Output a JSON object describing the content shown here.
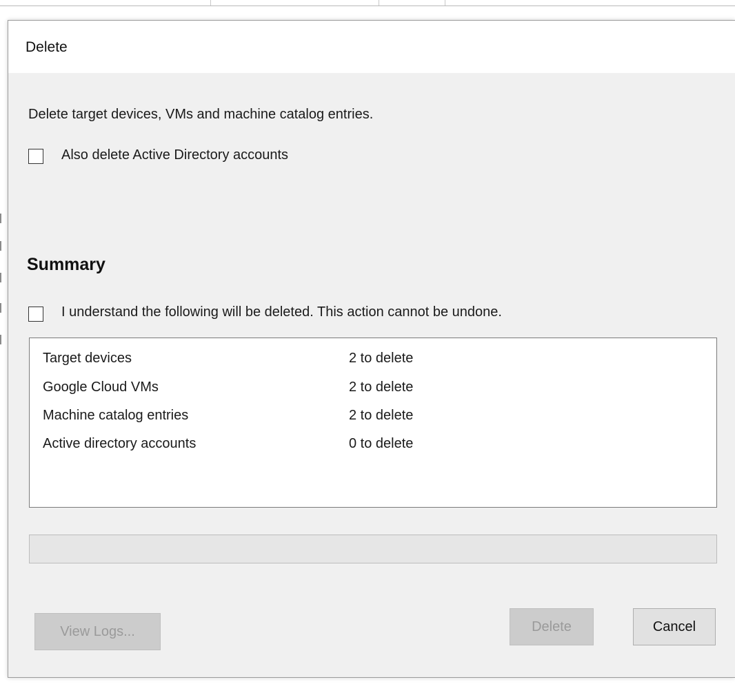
{
  "dialog": {
    "title": "Delete",
    "description": "Delete target devices, VMs and machine catalog entries.",
    "also_delete_ad": {
      "label": "Also delete Active Directory accounts",
      "checked": false
    },
    "summary": {
      "heading": "Summary",
      "acknowledge": {
        "label": "I understand the following will be deleted. This action cannot be undone.",
        "checked": false
      },
      "items": [
        {
          "name": "Target devices",
          "count": "2 to delete"
        },
        {
          "name": "Google Cloud VMs",
          "count": "2 to delete"
        },
        {
          "name": "Machine catalog entries",
          "count": "2 to delete"
        },
        {
          "name": "Active directory accounts",
          "count": "0 to delete"
        }
      ]
    },
    "progress": {
      "value": 0
    },
    "buttons": {
      "view_logs": {
        "label": "View Logs...",
        "enabled": false
      },
      "delete": {
        "label": "Delete",
        "enabled": false
      },
      "cancel": {
        "label": "Cancel",
        "enabled": true
      }
    }
  }
}
